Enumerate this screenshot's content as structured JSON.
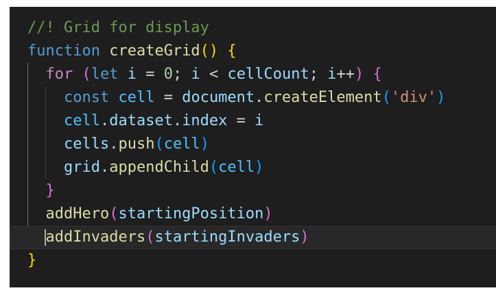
{
  "theme": {
    "background": "#1e1e1e",
    "comment": "#6a9955",
    "keyword": "#569cd6",
    "control": "#c586c0",
    "function": "#dcdcaa",
    "variable": "#9cdcfe",
    "constant": "#4fc1ff",
    "number": "#b5cea8",
    "string": "#ce9178",
    "bracket_level_1": "#ffd700",
    "bracket_level_2": "#da70d6",
    "bracket_level_3": "#179fff"
  },
  "code": {
    "lines": [
      [
        {
          "t": "//! Grid for display",
          "c": "comment"
        }
      ],
      [
        {
          "t": "function",
          "c": "kw"
        },
        {
          "t": " ",
          "c": "op"
        },
        {
          "t": "createGrid",
          "c": "fn"
        },
        {
          "t": "()",
          "c": "b1"
        },
        {
          "t": " ",
          "c": "op"
        },
        {
          "t": "{",
          "c": "b1"
        }
      ],
      [
        {
          "t": "  ",
          "c": "op"
        },
        {
          "t": "for",
          "c": "ctrl"
        },
        {
          "t": " ",
          "c": "op"
        },
        {
          "t": "(",
          "c": "b2"
        },
        {
          "t": "let",
          "c": "kw"
        },
        {
          "t": " ",
          "c": "op"
        },
        {
          "t": "i",
          "c": "var"
        },
        {
          "t": " = ",
          "c": "op"
        },
        {
          "t": "0",
          "c": "num"
        },
        {
          "t": "; ",
          "c": "op"
        },
        {
          "t": "i",
          "c": "var"
        },
        {
          "t": " < ",
          "c": "op"
        },
        {
          "t": "cellCount",
          "c": "var"
        },
        {
          "t": "; ",
          "c": "op"
        },
        {
          "t": "i",
          "c": "var"
        },
        {
          "t": "++",
          "c": "op"
        },
        {
          "t": ")",
          "c": "b2"
        },
        {
          "t": " ",
          "c": "op"
        },
        {
          "t": "{",
          "c": "b2"
        }
      ],
      [
        {
          "t": "    ",
          "c": "op"
        },
        {
          "t": "const",
          "c": "kw"
        },
        {
          "t": " ",
          "c": "op"
        },
        {
          "t": "cell",
          "c": "const"
        },
        {
          "t": " = ",
          "c": "op"
        },
        {
          "t": "document",
          "c": "var"
        },
        {
          "t": ".",
          "c": "op"
        },
        {
          "t": "createElement",
          "c": "fn"
        },
        {
          "t": "(",
          "c": "b3"
        },
        {
          "t": "'div'",
          "c": "str"
        },
        {
          "t": ")",
          "c": "b3"
        }
      ],
      [
        {
          "t": "    ",
          "c": "op"
        },
        {
          "t": "cell",
          "c": "const"
        },
        {
          "t": ".",
          "c": "op"
        },
        {
          "t": "dataset",
          "c": "var"
        },
        {
          "t": ".",
          "c": "op"
        },
        {
          "t": "index",
          "c": "var"
        },
        {
          "t": " = ",
          "c": "op"
        },
        {
          "t": "i",
          "c": "var"
        }
      ],
      [
        {
          "t": "    ",
          "c": "op"
        },
        {
          "t": "cells",
          "c": "var"
        },
        {
          "t": ".",
          "c": "op"
        },
        {
          "t": "push",
          "c": "fn"
        },
        {
          "t": "(",
          "c": "b3"
        },
        {
          "t": "cell",
          "c": "const"
        },
        {
          "t": ")",
          "c": "b3"
        }
      ],
      [
        {
          "t": "    ",
          "c": "op"
        },
        {
          "t": "grid",
          "c": "var"
        },
        {
          "t": ".",
          "c": "op"
        },
        {
          "t": "appendChild",
          "c": "fn"
        },
        {
          "t": "(",
          "c": "b3"
        },
        {
          "t": "cell",
          "c": "const"
        },
        {
          "t": ")",
          "c": "b3"
        }
      ],
      [
        {
          "t": "  ",
          "c": "op"
        },
        {
          "t": "}",
          "c": "b2"
        }
      ],
      [
        {
          "t": "  ",
          "c": "op"
        },
        {
          "t": "addHero",
          "c": "fn"
        },
        {
          "t": "(",
          "c": "b2"
        },
        {
          "t": "startingPosition",
          "c": "var"
        },
        {
          "t": ")",
          "c": "b2"
        }
      ],
      [
        {
          "t": "  ",
          "c": "op"
        },
        {
          "t": "addInvaders",
          "c": "fn"
        },
        {
          "t": "(",
          "c": "b2"
        },
        {
          "t": "startingInvaders",
          "c": "var"
        },
        {
          "t": ")",
          "c": "b2"
        }
      ],
      [
        {
          "t": "}",
          "c": "b1"
        }
      ]
    ],
    "current_line": 9
  }
}
